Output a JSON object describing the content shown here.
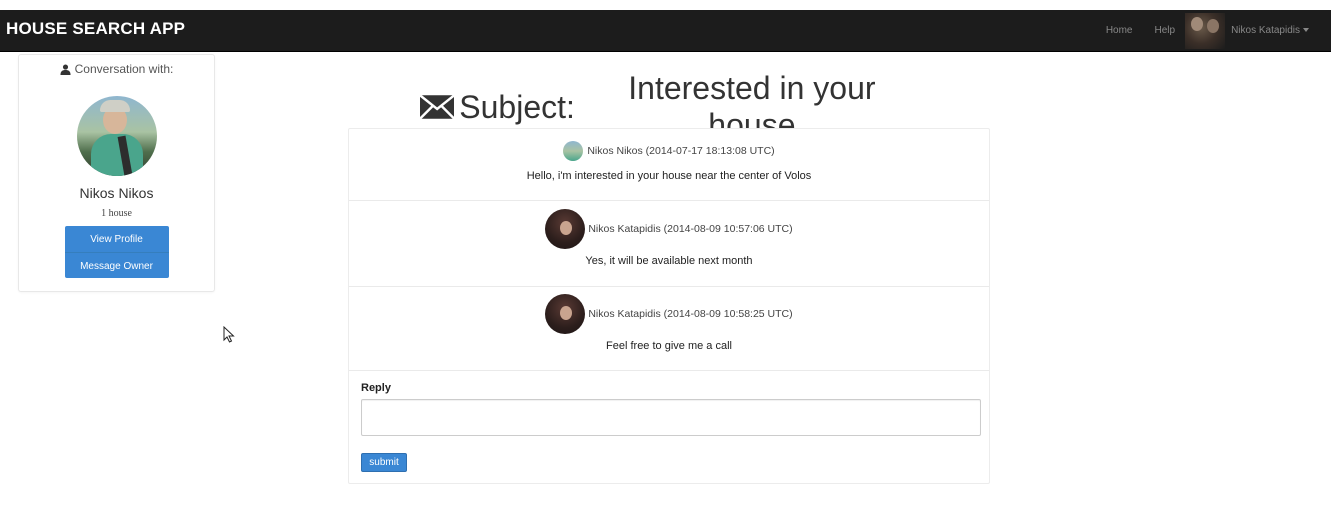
{
  "app": {
    "title": "HOUSE SEARCH APP"
  },
  "nav": {
    "home": "Home",
    "help": "Help",
    "user": "Nikos Katapidis"
  },
  "sidebar": {
    "conversation_with": "Conversation with:",
    "owner_name": "Nikos Nikos",
    "house_count": "1 house",
    "view_profile": "View Profile",
    "message_owner": "Message Owner"
  },
  "subject": {
    "prefix": "Subject:",
    "text": "Interested in your house"
  },
  "messages": [
    {
      "author": "Nikos Nikos",
      "timestamp": "(2014-07-17 18:13:08 UTC)",
      "body": "Hello, i'm interested in your house near the center of Volos"
    },
    {
      "author": "Nikos Katapidis",
      "timestamp": "(2014-08-09 10:57:06 UTC)",
      "body": "Yes, it will be available next month"
    },
    {
      "author": "Nikos Katapidis",
      "timestamp": "(2014-08-09 10:58:25 UTC)",
      "body": "Feel free to give me a call"
    }
  ],
  "reply": {
    "label": "Reply",
    "value": "",
    "submit": "submit"
  },
  "colors": {
    "navbar": "#1c1c1c",
    "primary_button": "#3a87d4"
  },
  "icons": {
    "conversation": "user-icon",
    "subject": "envelope-icon"
  }
}
